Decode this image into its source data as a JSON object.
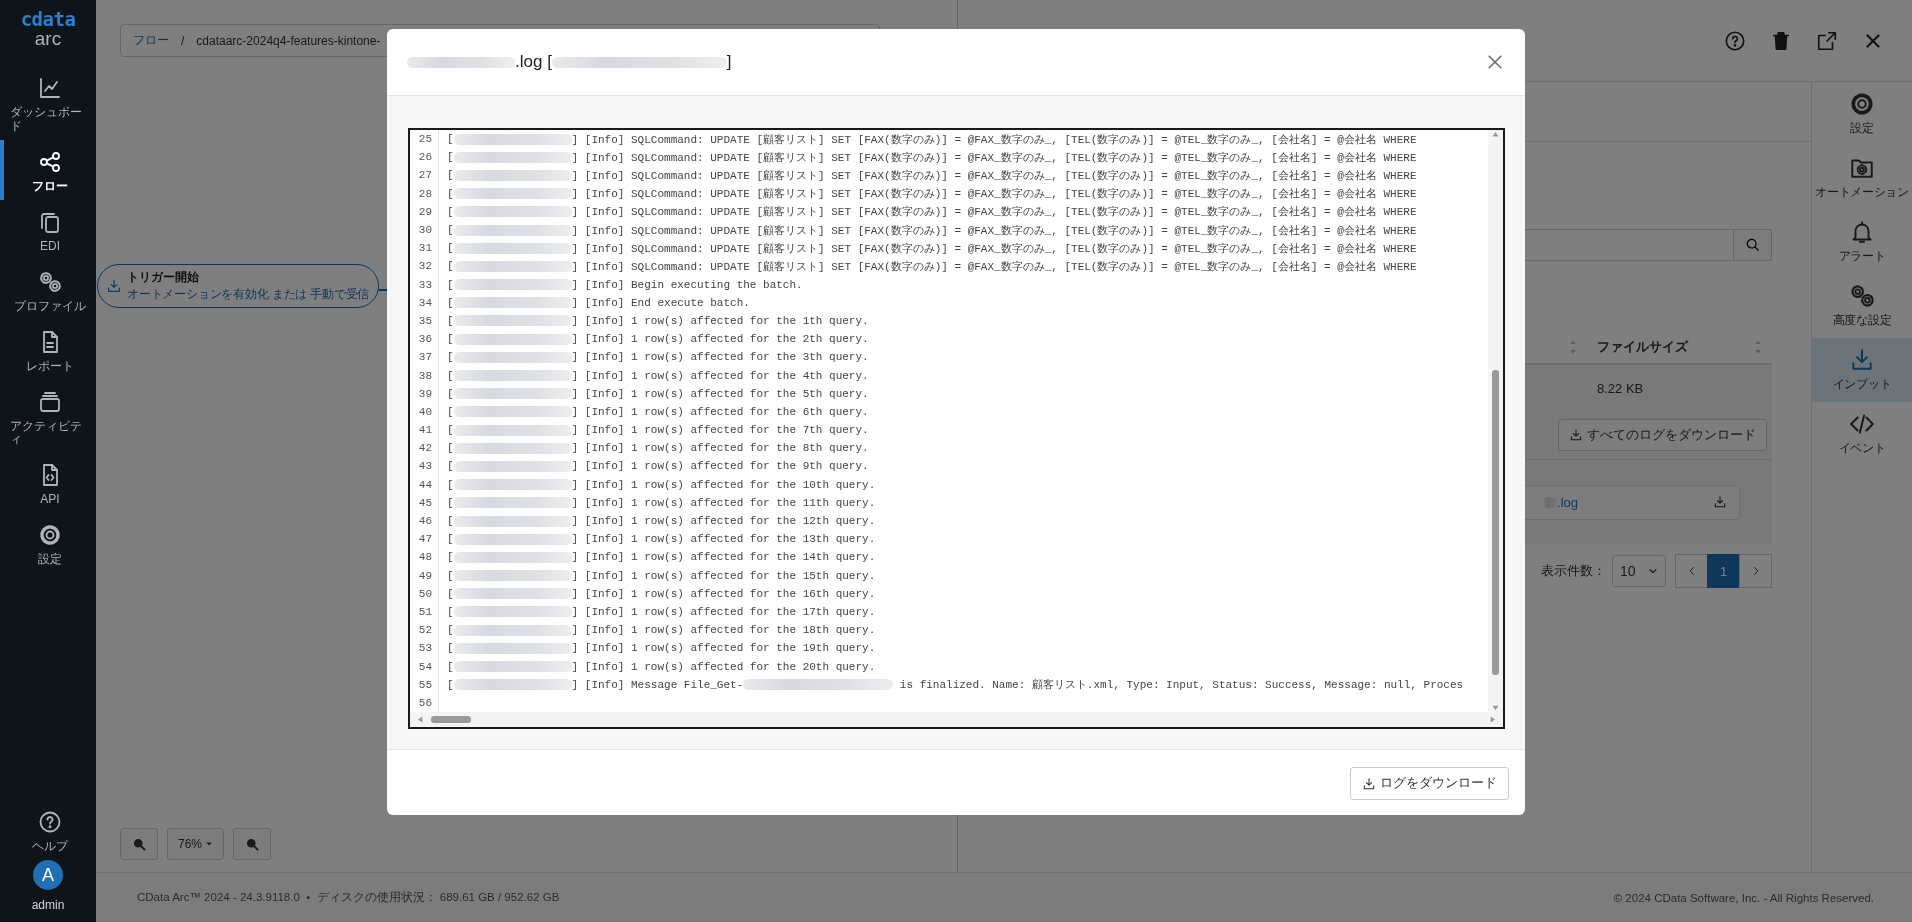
{
  "sidebar": {
    "logo": {
      "brand": "cdata",
      "product": "arc"
    },
    "items": [
      {
        "label": "ダッシュボード",
        "selected": false
      },
      {
        "label": "フロー",
        "selected": true
      },
      {
        "label": "EDI",
        "selected": false
      },
      {
        "label": "プロファイル",
        "selected": false
      },
      {
        "label": "レポート",
        "selected": false
      },
      {
        "label": "アクティビティ",
        "selected": false
      },
      {
        "label": "API",
        "selected": false
      },
      {
        "label": "設定",
        "selected": false
      }
    ],
    "help": {
      "label": "ヘルプ"
    },
    "user": {
      "initial": "A",
      "name": "admin"
    }
  },
  "breadcrumb": {
    "root": "フロー",
    "separator": "/",
    "current": "cdataarc-2024q4-features-kintone-"
  },
  "canvas": {
    "node": {
      "title": "トリガー開始",
      "subtitle": "オートメーションを有効化 または 手動で受信"
    },
    "zoom_text": "76%"
  },
  "right_panel": {
    "table": {
      "column": "ファイルサイズ",
      "file_size": "8.22 KB"
    },
    "download_all_button": "すべてのログをダウンロード",
    "log_file": {
      "name_suffix": ".log"
    },
    "page_size": {
      "label": "表示件数：",
      "value": "10"
    },
    "pages": [
      {
        "label": "1",
        "selected": true
      }
    ],
    "rail": [
      {
        "label": "設定",
        "selected": false
      },
      {
        "label": "オートメーション",
        "selected": false
      },
      {
        "label": "アラート",
        "selected": false
      },
      {
        "label": "高度な設定",
        "selected": false
      },
      {
        "label": "インプット",
        "selected": true
      },
      {
        "label": "イベント",
        "selected": false
      }
    ]
  },
  "modal": {
    "title": [
      {
        "kind": "redacted"
      },
      {
        "kind": "text",
        "text": ".log ["
      },
      {
        "kind": "redacted"
      },
      {
        "kind": "text",
        "text": "]"
      }
    ],
    "lines": [
      {
        "number": "25",
        "parts": [
          "[",
          "] [Info] SQLCommand: UPDATE [顧客リスト] SET [FAX(数字のみ)] = @FAX_数字のみ_, [TEL(数字のみ)] = @TEL_数字のみ_, [会社名] = @会社名 WHERE"
        ]
      },
      {
        "number": "26",
        "parts": [
          "[",
          "] [Info] SQLCommand: UPDATE [顧客リスト] SET [FAX(数字のみ)] = @FAX_数字のみ_, [TEL(数字のみ)] = @TEL_数字のみ_, [会社名] = @会社名 WHERE"
        ]
      },
      {
        "number": "27",
        "parts": [
          "[",
          "] [Info] SQLCommand: UPDATE [顧客リスト] SET [FAX(数字のみ)] = @FAX_数字のみ_, [TEL(数字のみ)] = @TEL_数字のみ_, [会社名] = @会社名 WHERE"
        ]
      },
      {
        "number": "28",
        "parts": [
          "[",
          "] [Info] SQLCommand: UPDATE [顧客リスト] SET [FAX(数字のみ)] = @FAX_数字のみ_, [TEL(数字のみ)] = @TEL_数字のみ_, [会社名] = @会社名 WHERE"
        ]
      },
      {
        "number": "29",
        "parts": [
          "[",
          "] [Info] SQLCommand: UPDATE [顧客リスト] SET [FAX(数字のみ)] = @FAX_数字のみ_, [TEL(数字のみ)] = @TEL_数字のみ_, [会社名] = @会社名 WHERE"
        ]
      },
      {
        "number": "30",
        "parts": [
          "[",
          "] [Info] SQLCommand: UPDATE [顧客リスト] SET [FAX(数字のみ)] = @FAX_数字のみ_, [TEL(数字のみ)] = @TEL_数字のみ_, [会社名] = @会社名 WHERE"
        ]
      },
      {
        "number": "31",
        "parts": [
          "[",
          "] [Info] SQLCommand: UPDATE [顧客リスト] SET [FAX(数字のみ)] = @FAX_数字のみ_, [TEL(数字のみ)] = @TEL_数字のみ_, [会社名] = @会社名 WHERE"
        ]
      },
      {
        "number": "32",
        "parts": [
          "[",
          "] [Info] SQLCommand: UPDATE [顧客リスト] SET [FAX(数字のみ)] = @FAX_数字のみ_, [TEL(数字のみ)] = @TEL_数字のみ_, [会社名] = @会社名 WHERE"
        ]
      },
      {
        "number": "33",
        "parts": [
          "[",
          "] [Info] Begin executing the batch."
        ]
      },
      {
        "number": "34",
        "parts": [
          "[",
          "] [Info] End execute batch."
        ]
      },
      {
        "number": "35",
        "parts": [
          "[",
          "] [Info] 1 row(s) affected for the 1th query."
        ]
      },
      {
        "number": "36",
        "parts": [
          "[",
          "] [Info] 1 row(s) affected for the 2th query."
        ]
      },
      {
        "number": "37",
        "parts": [
          "[",
          "] [Info] 1 row(s) affected for the 3th query."
        ]
      },
      {
        "number": "38",
        "parts": [
          "[",
          "] [Info] 1 row(s) affected for the 4th query."
        ]
      },
      {
        "number": "39",
        "parts": [
          "[",
          "] [Info] 1 row(s) affected for the 5th query."
        ]
      },
      {
        "number": "40",
        "parts": [
          "[",
          "] [Info] 1 row(s) affected for the 6th query."
        ]
      },
      {
        "number": "41",
        "parts": [
          "[",
          "] [Info] 1 row(s) affected for the 7th query."
        ]
      },
      {
        "number": "42",
        "parts": [
          "[",
          "] [Info] 1 row(s) affected for the 8th query."
        ]
      },
      {
        "number": "43",
        "parts": [
          "[",
          "] [Info] 1 row(s) affected for the 9th query."
        ]
      },
      {
        "number": "44",
        "parts": [
          "[",
          "] [Info] 1 row(s) affected for the 10th query."
        ]
      },
      {
        "number": "45",
        "parts": [
          "[",
          "] [Info] 1 row(s) affected for the 11th query."
        ]
      },
      {
        "number": "46",
        "parts": [
          "[",
          "] [Info] 1 row(s) affected for the 12th query."
        ]
      },
      {
        "number": "47",
        "parts": [
          "[",
          "] [Info] 1 row(s) affected for the 13th query."
        ]
      },
      {
        "number": "48",
        "parts": [
          "[",
          "] [Info] 1 row(s) affected for the 14th query."
        ]
      },
      {
        "number": "49",
        "parts": [
          "[",
          "] [Info] 1 row(s) affected for the 15th query."
        ]
      },
      {
        "number": "50",
        "parts": [
          "[",
          "] [Info] 1 row(s) affected for the 16th query."
        ]
      },
      {
        "number": "51",
        "parts": [
          "[",
          "] [Info] 1 row(s) affected for the 17th query."
        ]
      },
      {
        "number": "52",
        "parts": [
          "[",
          "] [Info] 1 row(s) affected for the 18th query."
        ]
      },
      {
        "number": "53",
        "parts": [
          "[",
          "] [Info] 1 row(s) affected for the 19th query."
        ]
      },
      {
        "number": "54",
        "parts": [
          "[",
          "] [Info] 1 row(s) affected for the 20th query."
        ]
      },
      {
        "number": "55",
        "parts": [
          "[",
          "] [Info] Message File_Get-",
          " is finalized. Name: 顧客リスト.xml, Type: Input, Status: Success, Message: null, Proces"
        ]
      },
      {
        "number": "56"
      }
    ],
    "download_button": "ログをダウンロード"
  },
  "footer": {
    "info": "CData Arc™ 2024 - 24.3.9118.0  •  ディスクの使用状況： 689.61 GB / 952.62 GB",
    "copyright": "© 2024 CData Software, Inc. - All Rights Reserved."
  }
}
